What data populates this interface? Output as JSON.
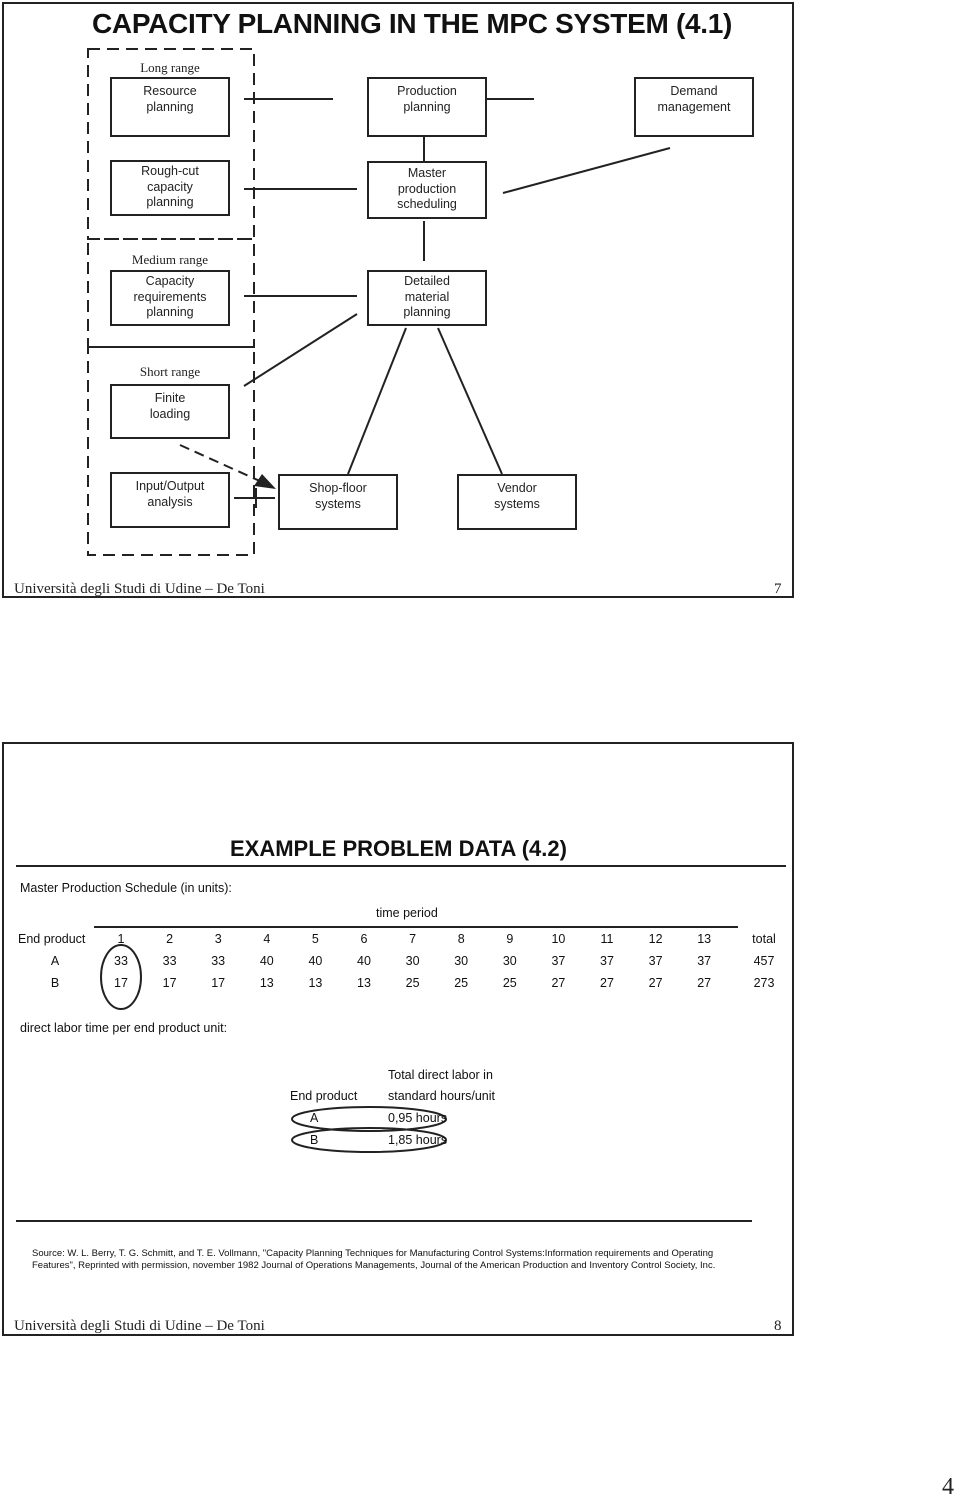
{
  "slide1": {
    "title": "CAPACITY PLANNING IN THE MPC SYSTEM (4.1)",
    "range_labels": {
      "long": "Long range",
      "medium": "Medium range",
      "short": "Short range"
    },
    "boxes": {
      "resource_planning": [
        "Resource",
        "planning"
      ],
      "production_planning": [
        "Production",
        "planning"
      ],
      "demand_management": [
        "Demand",
        "management"
      ],
      "rough_cut": [
        "Rough-cut",
        "capacity",
        "planning"
      ],
      "mps": [
        "Master",
        "production",
        "scheduling"
      ],
      "crp": [
        "Capacity",
        "requirements",
        "planning"
      ],
      "detailed_material": [
        "Detailed",
        "material",
        "planning"
      ],
      "finite_loading": [
        "Finite",
        "loading"
      ],
      "input_output": [
        "Input/Output",
        "analysis"
      ],
      "shop_floor": [
        "Shop-floor",
        "systems"
      ],
      "vendor": [
        "Vendor",
        "systems"
      ]
    },
    "footer": {
      "text": "Università degli Studi di Udine – De Toni",
      "page": "7"
    }
  },
  "slide2": {
    "title": "EXAMPLE PROBLEM DATA (4.2)",
    "mps_label": "Master Production Schedule (in units):",
    "time_period_label": "time period",
    "table": {
      "row_header": "End product",
      "periods": [
        "1",
        "2",
        "3",
        "4",
        "5",
        "6",
        "7",
        "8",
        "9",
        "10",
        "11",
        "12",
        "13"
      ],
      "total_label": "total",
      "rows": [
        {
          "product": "A",
          "values": [
            "33",
            "33",
            "33",
            "40",
            "40",
            "40",
            "30",
            "30",
            "30",
            "37",
            "37",
            "37",
            "37"
          ],
          "total": "457"
        },
        {
          "product": "B",
          "values": [
            "17",
            "17",
            "17",
            "13",
            "13",
            "13",
            "25",
            "25",
            "25",
            "27",
            "27",
            "27",
            "27"
          ],
          "total": "273"
        }
      ]
    },
    "labor_label": "direct labor time per end product unit:",
    "labor_table": {
      "col1_header": "End product",
      "col2_header_line1": "Total direct labor in",
      "col2_header_line2": "standard hours/unit",
      "rows": [
        {
          "product": "A",
          "hours": "0,95 hours"
        },
        {
          "product": "B",
          "hours": "1,85 hours"
        }
      ]
    },
    "source_line1": "Source: W. L. Berry, T. G. Schmitt, and T. E. Vollmann, \"Capacity Planning Techniques for Manufacturing Control Systems:Information requirements and Operating",
    "source_line2": "Features\",  Reprinted with permission, november 1982 Journal of Operations Managements, Journal of the American Production and Inventory Control Society, Inc.",
    "footer": {
      "text": "Università degli Studi di Udine – De Toni",
      "page": "8"
    }
  },
  "document_page_number": "4"
}
